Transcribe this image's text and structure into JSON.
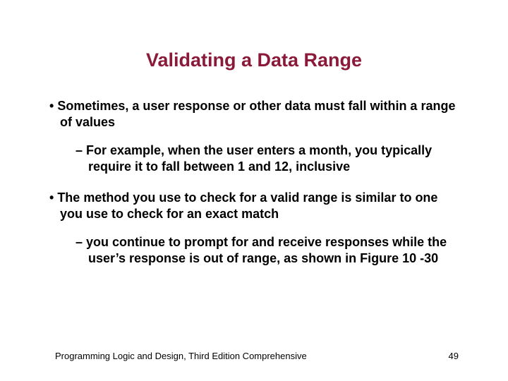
{
  "title": "Validating a Data Range",
  "bullets": {
    "b1": "Sometimes, a user response or other data must fall within a range of values",
    "b1sub": "For example, when the user enters a month, you typically require it to fall between 1 and 12, inclusive",
    "b2": "The method you use to check for a valid range is similar to one you use to check for an exact match",
    "b2sub": "you continue to prompt for and receive responses while the user’s response is out of range, as shown in Figure 10 -30"
  },
  "footer": {
    "source": "Programming Logic and Design, Third Edition Comprehensive",
    "page": "49"
  }
}
